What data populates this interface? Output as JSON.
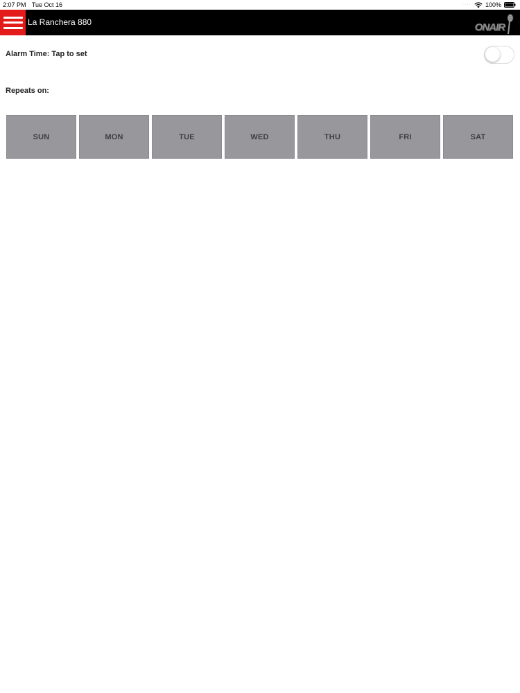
{
  "status_bar": {
    "time": "2:07 PM",
    "date": "Tue Oct 16",
    "signal": "····",
    "battery_percent": "100%",
    "battery_level": 1.0
  },
  "header": {
    "title": "La Ranchera 880",
    "logo_text": "ONAIR",
    "menu_icon": "hamburger-menu-icon",
    "accent_color": "#e31b1b"
  },
  "alarm": {
    "label": "Alarm Time: Tap to set",
    "enabled": false
  },
  "repeats": {
    "label": "Repeats on:",
    "days": [
      {
        "label": "SUN"
      },
      {
        "label": "MON"
      },
      {
        "label": "TUE"
      },
      {
        "label": "WED"
      },
      {
        "label": "THU"
      },
      {
        "label": "FRI"
      },
      {
        "label": "SAT"
      }
    ]
  }
}
